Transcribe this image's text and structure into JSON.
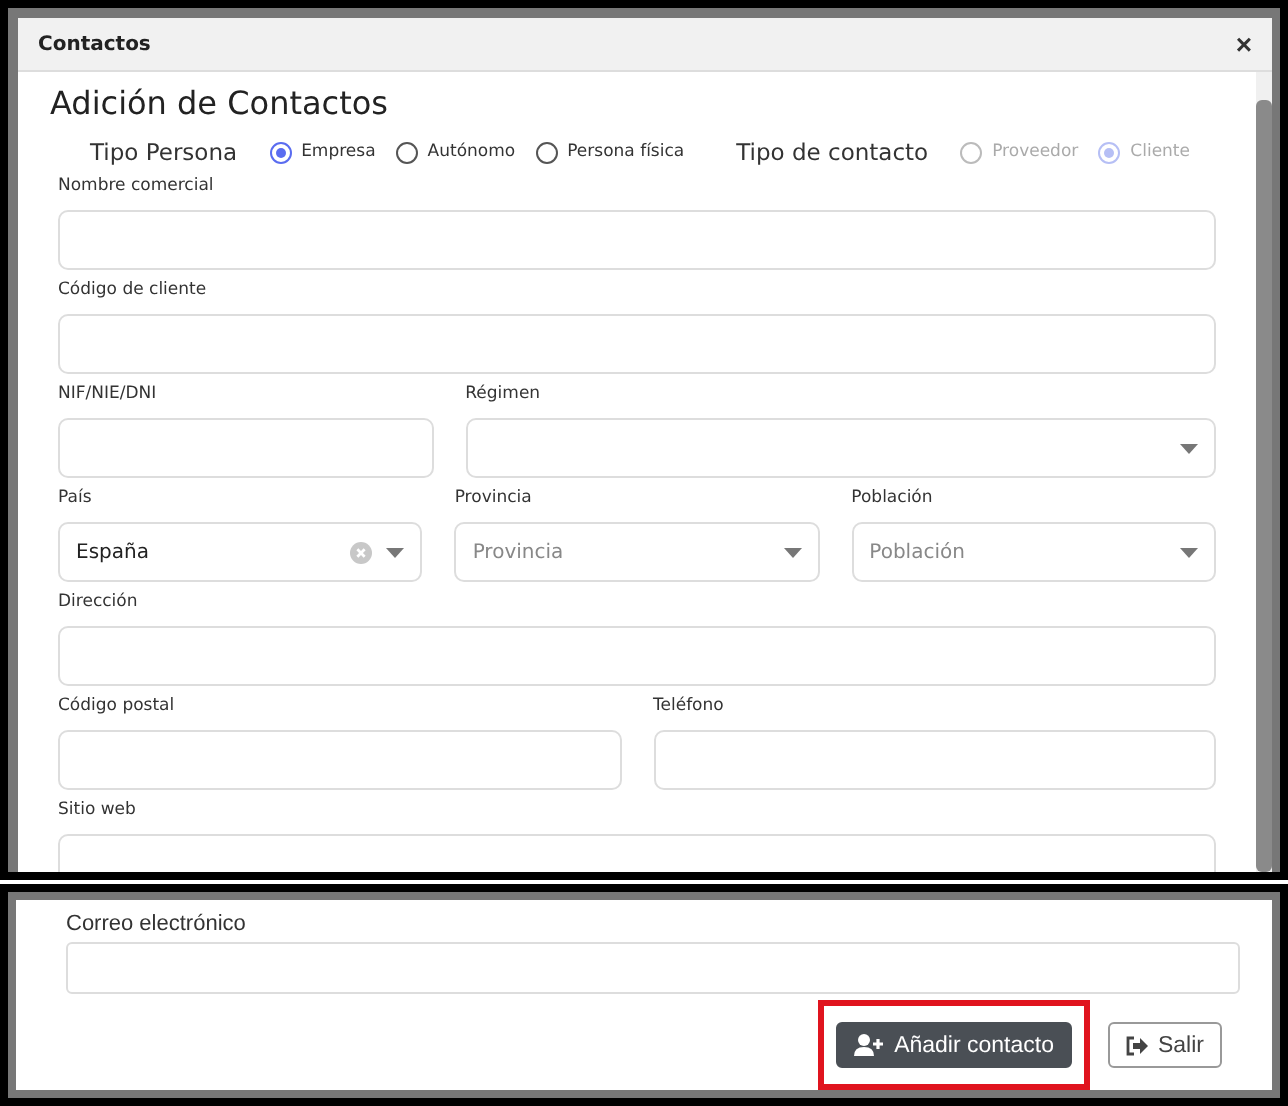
{
  "window": {
    "title": "Contactos",
    "close": "×"
  },
  "heading": "Adición de Contactos",
  "radio_groups": [
    {
      "label": "Tipo Persona",
      "options": [
        {
          "label": "Empresa",
          "selected": true,
          "disabled": false
        },
        {
          "label": "Autónomo",
          "selected": false,
          "disabled": false
        },
        {
          "label": "Persona física",
          "selected": false,
          "disabled": false
        }
      ]
    },
    {
      "label": "Tipo de contacto",
      "options": [
        {
          "label": "Proveedor",
          "selected": false,
          "disabled": true
        },
        {
          "label": "Cliente",
          "selected": true,
          "disabled": true
        }
      ]
    }
  ],
  "rows": [
    [
      {
        "label": "Nombre comercial",
        "kind": "input"
      }
    ],
    [
      {
        "label": "Código de cliente",
        "kind": "input"
      }
    ],
    [
      {
        "label": "NIF/NIE/DNI",
        "kind": "input"
      },
      {
        "label": "Régimen",
        "kind": "select"
      }
    ],
    [
      {
        "label": "País",
        "kind": "select",
        "value": "España",
        "clearable": true
      },
      {
        "label": "Provincia",
        "kind": "select",
        "placeholder": "Provincia"
      },
      {
        "label": "Población",
        "kind": "select",
        "placeholder": "Población"
      }
    ],
    [
      {
        "label": "Dirección",
        "kind": "input"
      }
    ],
    [
      {
        "label": "Código postal",
        "kind": "input"
      },
      {
        "label": "Teléfono",
        "kind": "input"
      }
    ],
    [
      {
        "label": "Sitio web",
        "kind": "input"
      }
    ]
  ],
  "lower": {
    "fields": [
      {
        "label": "Correo electrónico",
        "kind": "input"
      }
    ],
    "buttons": [
      {
        "label": "Añadir contacto",
        "kind": "primary",
        "highlighted": true
      },
      {
        "label": "Salir",
        "kind": "outline"
      }
    ]
  }
}
